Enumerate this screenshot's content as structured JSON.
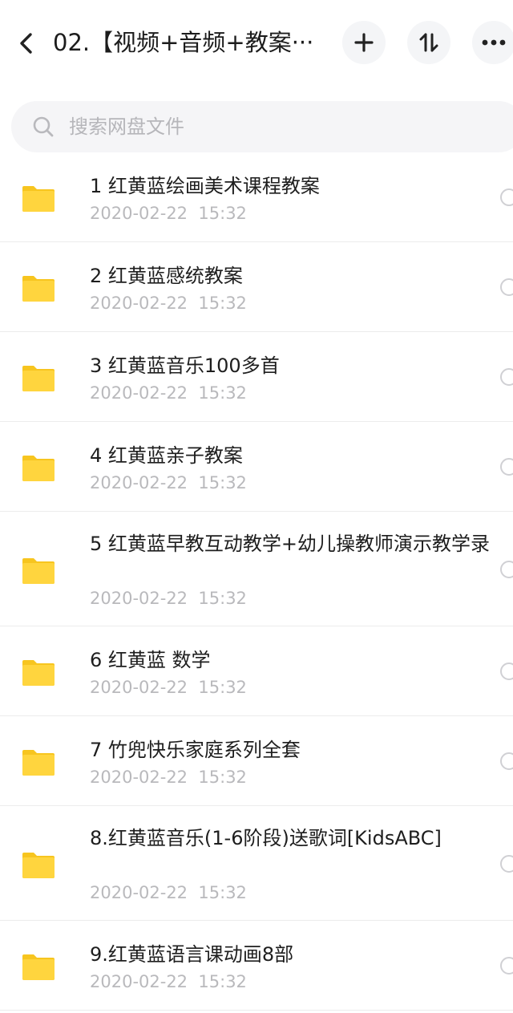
{
  "header": {
    "title": "02.【视频+音频+教案···",
    "back_icon": "chevron-left-icon",
    "add_icon": "plus-icon",
    "sort_icon": "sort-icon",
    "more_icon": "more-dots-icon"
  },
  "search": {
    "placeholder": "搜索网盘文件",
    "icon": "search-icon"
  },
  "colors": {
    "folder": "#FFD53E",
    "folder_back": "#F7C51F",
    "date_text": "#B9B9BC",
    "search_bg": "#F5F5F7"
  },
  "files": [
    {
      "name": "1  红黄蓝绘画美术课程教案",
      "date": "2020-02-22  15:32"
    },
    {
      "name": "2 红黄蓝感统教案",
      "date": "2020-02-22  15:32"
    },
    {
      "name": "3 红黄蓝音乐100多首",
      "date": "2020-02-22  15:32"
    },
    {
      "name": "4 红黄蓝亲子教案",
      "date": "2020-02-22  15:32"
    },
    {
      "name": "5  红黄蓝早教互动教学+幼儿操教师演示教学录",
      "date": "2020-02-22  15:32"
    },
    {
      "name": "6  红黄蓝 数学",
      "date": "2020-02-22  15:32"
    },
    {
      "name": "7  竹兜快乐家庭系列全套",
      "date": "2020-02-22  15:32"
    },
    {
      "name": "8.红黄蓝音乐(1-6阶段)送歌词[KidsABC]",
      "date": "2020-02-22  15:32"
    },
    {
      "name": "9.红黄蓝语言课动画8部",
      "date": "2020-02-22  15:32"
    }
  ]
}
